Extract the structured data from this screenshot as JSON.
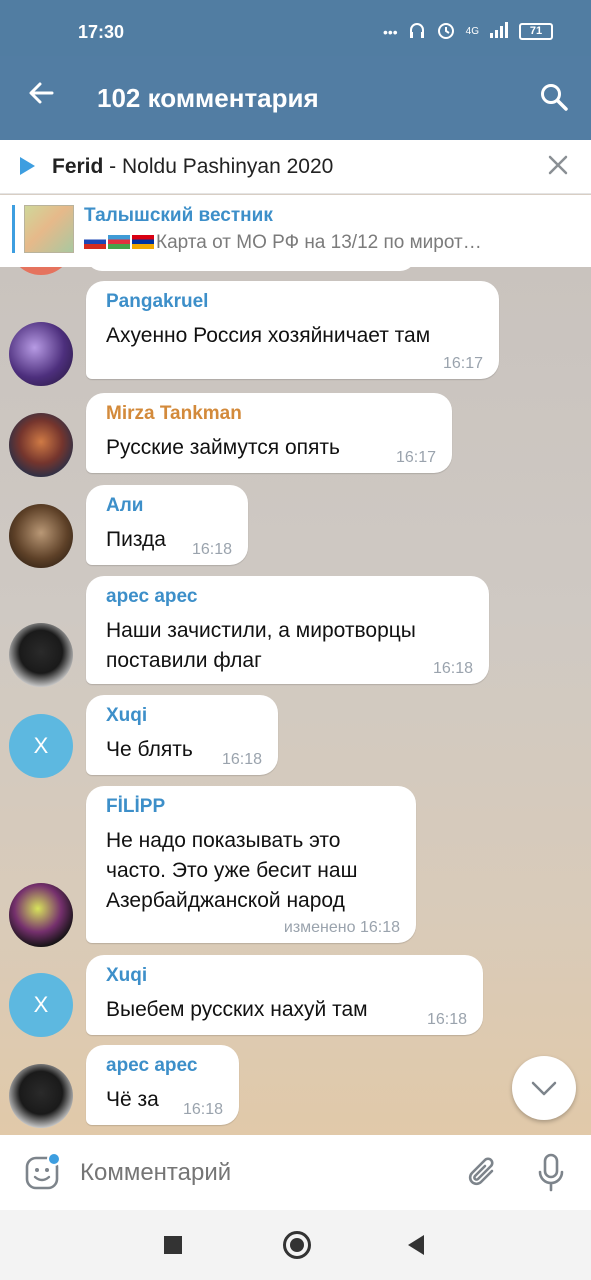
{
  "status_bar": {
    "time": "17:30",
    "network": "4G",
    "battery": "71"
  },
  "header": {
    "title": "102 комментария"
  },
  "pinned": {
    "author": "Ferid",
    "separator": " - ",
    "title": "Noldu Pashinyan 2020"
  },
  "reply_preview": {
    "channel": "Талышский вестник",
    "snippet": "Карта от МО РФ на 13/12 по мирот…"
  },
  "messages": [
    {
      "author": "Pangakruel",
      "author_color": "#3d8fc9",
      "text": "Ахуенно Россия хозяйничает там",
      "time": "16:17",
      "avatar_icon": "user-avatar-photo"
    },
    {
      "author": "Mirza Tankman",
      "author_color": "#d38a3b",
      "text": "Русские займутся опять",
      "time": "16:17",
      "avatar_icon": "user-avatar-photo"
    },
    {
      "author": "Али",
      "author_color": "#3d8fc9",
      "text": "Пизда",
      "time": "16:18",
      "avatar_icon": "user-avatar-photo"
    },
    {
      "author": "арес арес",
      "author_color": "#3d8fc9",
      "text": "Наши зачистили, а миротворцы поставили флаг",
      "time": "16:18",
      "avatar_icon": "user-avatar-photo"
    },
    {
      "author": "Xuqi",
      "author_color": "#3d8fc9",
      "text": "Че блять",
      "time": "16:18",
      "avatar_letter": "X"
    },
    {
      "author": "FİLİPP",
      "author_color": "#3d8fc9",
      "text": "Не надо показывать это часто. Это уже бесит наш Азербайджанской народ",
      "time": "изменено 16:18",
      "avatar_icon": "user-avatar-photo"
    },
    {
      "author": "Xuqi",
      "author_color": "#3d8fc9",
      "text": "Выебем русских нахуй там",
      "time": "16:18",
      "avatar_letter": "X"
    },
    {
      "author": "арес арес",
      "author_color": "#3d8fc9",
      "text": "Чё за",
      "time": "16:18",
      "avatar_icon": "user-avatar-photo"
    }
  ],
  "composer": {
    "placeholder": "Комментарий"
  },
  "colors": {
    "header": "#527da3",
    "accent": "#3d9ee0"
  }
}
